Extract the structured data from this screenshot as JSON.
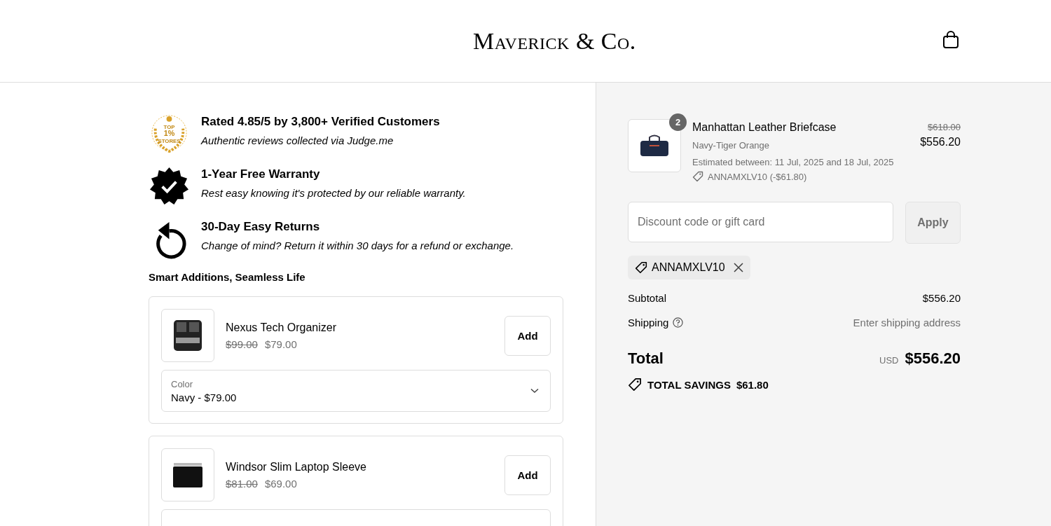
{
  "header": {
    "logo": "Maverick & Co."
  },
  "trust_badges": [
    {
      "kind": "rating",
      "badge_text": [
        "TOP",
        "1%",
        "STORES"
      ],
      "title": "Rated 4.85/5 by 3,800+ Verified Customers",
      "subtitle": "Authentic reviews collected via Judge.me"
    },
    {
      "kind": "warranty",
      "title": "1-Year Free Warranty",
      "subtitle": "Rest easy knowing it's protected by our reliable warranty."
    },
    {
      "kind": "returns",
      "title": "30-Day Easy Returns",
      "subtitle": "Change of mind? Return it within 30 days for a refund or exchange."
    }
  ],
  "upsell": {
    "heading": "Smart Additions, Seamless Life",
    "products": [
      {
        "kind": "organizer",
        "name": "Nexus Tech Organizer",
        "compare_price": "$99.00",
        "price": "$79.00",
        "button": "Add",
        "option_label": "Color",
        "option_value": "Navy - $79.00"
      },
      {
        "kind": "sleeve",
        "name": "Windsor Slim Laptop Sleeve",
        "compare_price": "$81.00",
        "price": "$69.00",
        "button": "Add"
      }
    ]
  },
  "order_summary": {
    "items": [
      {
        "quantity": "2",
        "name": "Manhattan Leather Briefcase",
        "variant": "Navy-Tiger Orange",
        "estimate": "Estimated between: 11 Jul, 2025 and 18 Jul, 2025",
        "discount": "ANNAMXLV10 (-$61.80)",
        "compare_price": "$618.00",
        "price": "$556.20"
      }
    ],
    "discount_field": {
      "placeholder": "Discount code or gift card"
    },
    "apply_button": "Apply",
    "applied_code": "ANNAMXLV10",
    "subtotal": {
      "label": "Subtotal",
      "value": "$556.20"
    },
    "shipping": {
      "label": "Shipping",
      "value": "Enter shipping address"
    },
    "total": {
      "label": "Total",
      "currency": "USD",
      "value": "$556.20"
    },
    "savings": {
      "label": "TOTAL SAVINGS",
      "value": "$61.80"
    }
  }
}
